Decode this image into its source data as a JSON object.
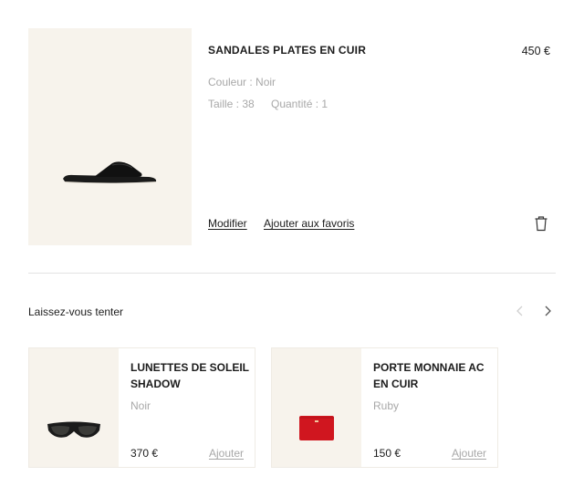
{
  "cart_item": {
    "name": "SANDALES PLATES EN CUIR",
    "price": "450 €",
    "color_line": "Couleur : Noir",
    "size_line": "Taille : 38",
    "quantity_line": "Quantité : 1",
    "modify_label": "Modifier",
    "favorite_label": "Ajouter aux favoris",
    "image_icon": "sandal",
    "delete_icon": "trash-icon"
  },
  "suggestions": {
    "title": "Laissez-vous tenter",
    "prev_icon": "chevron-left-icon",
    "next_icon": "chevron-right-icon",
    "items": [
      {
        "name": "LUNETTES DE SOLEIL SHADOW",
        "variant": "Noir",
        "price": "370 €",
        "add_label": "Ajouter",
        "image_icon": "sunglasses"
      },
      {
        "name": "PORTE MONNAIE AC EN CUIR",
        "variant": "Ruby",
        "price": "150 €",
        "add_label": "Ajouter",
        "image_icon": "coin-purse"
      }
    ]
  },
  "colors": {
    "image_background": "#f7f3ec",
    "text_primary": "#1c1c1c",
    "text_muted": "#a8a8a8",
    "purse_red": "#d0161f"
  }
}
